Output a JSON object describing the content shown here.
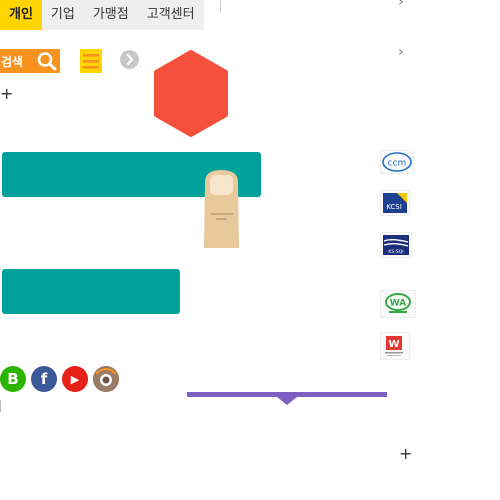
{
  "tabs": [
    {
      "label": "개인",
      "active": true
    },
    {
      "label": "기업",
      "active": false
    },
    {
      "label": "가맹점",
      "active": false
    },
    {
      "label": "고객센터",
      "active": false
    }
  ],
  "search": {
    "label": "검색",
    "icon": "search-icon"
  },
  "menu": {
    "icon": "hamburger-menu-icon"
  },
  "next": {
    "icon": "chevron-right-icon"
  },
  "controls": {
    "plus": "+",
    "chevron": "›"
  },
  "badges": [
    {
      "icon": "ccm-certification-icon",
      "text": "ccm"
    },
    {
      "icon": "kcsi-certification-icon",
      "text": "KCSI"
    },
    {
      "icon": "ks-sqi-certification-icon",
      "text": "KS-SQI"
    },
    {
      "icon": "wa-accessibility-certification-icon",
      "text": "WA"
    },
    {
      "icon": "web-award-icon",
      "text": "W"
    }
  ],
  "social": [
    {
      "icon": "blog-icon",
      "text": "B",
      "color": "#2db400"
    },
    {
      "icon": "facebook-icon",
      "text": "f",
      "color": "#3b5998"
    },
    {
      "icon": "youtube-icon",
      "text": "▶",
      "color": "#e62117"
    },
    {
      "icon": "instagram-icon",
      "text": "",
      "color": "#8a6d5a"
    }
  ],
  "colors": {
    "accent_yellow": "#ffd400",
    "search_orange": "#f7931e",
    "teal": "#00a19a",
    "hexagon": "#f4503c",
    "bar_purple": "#7e5fc4"
  }
}
